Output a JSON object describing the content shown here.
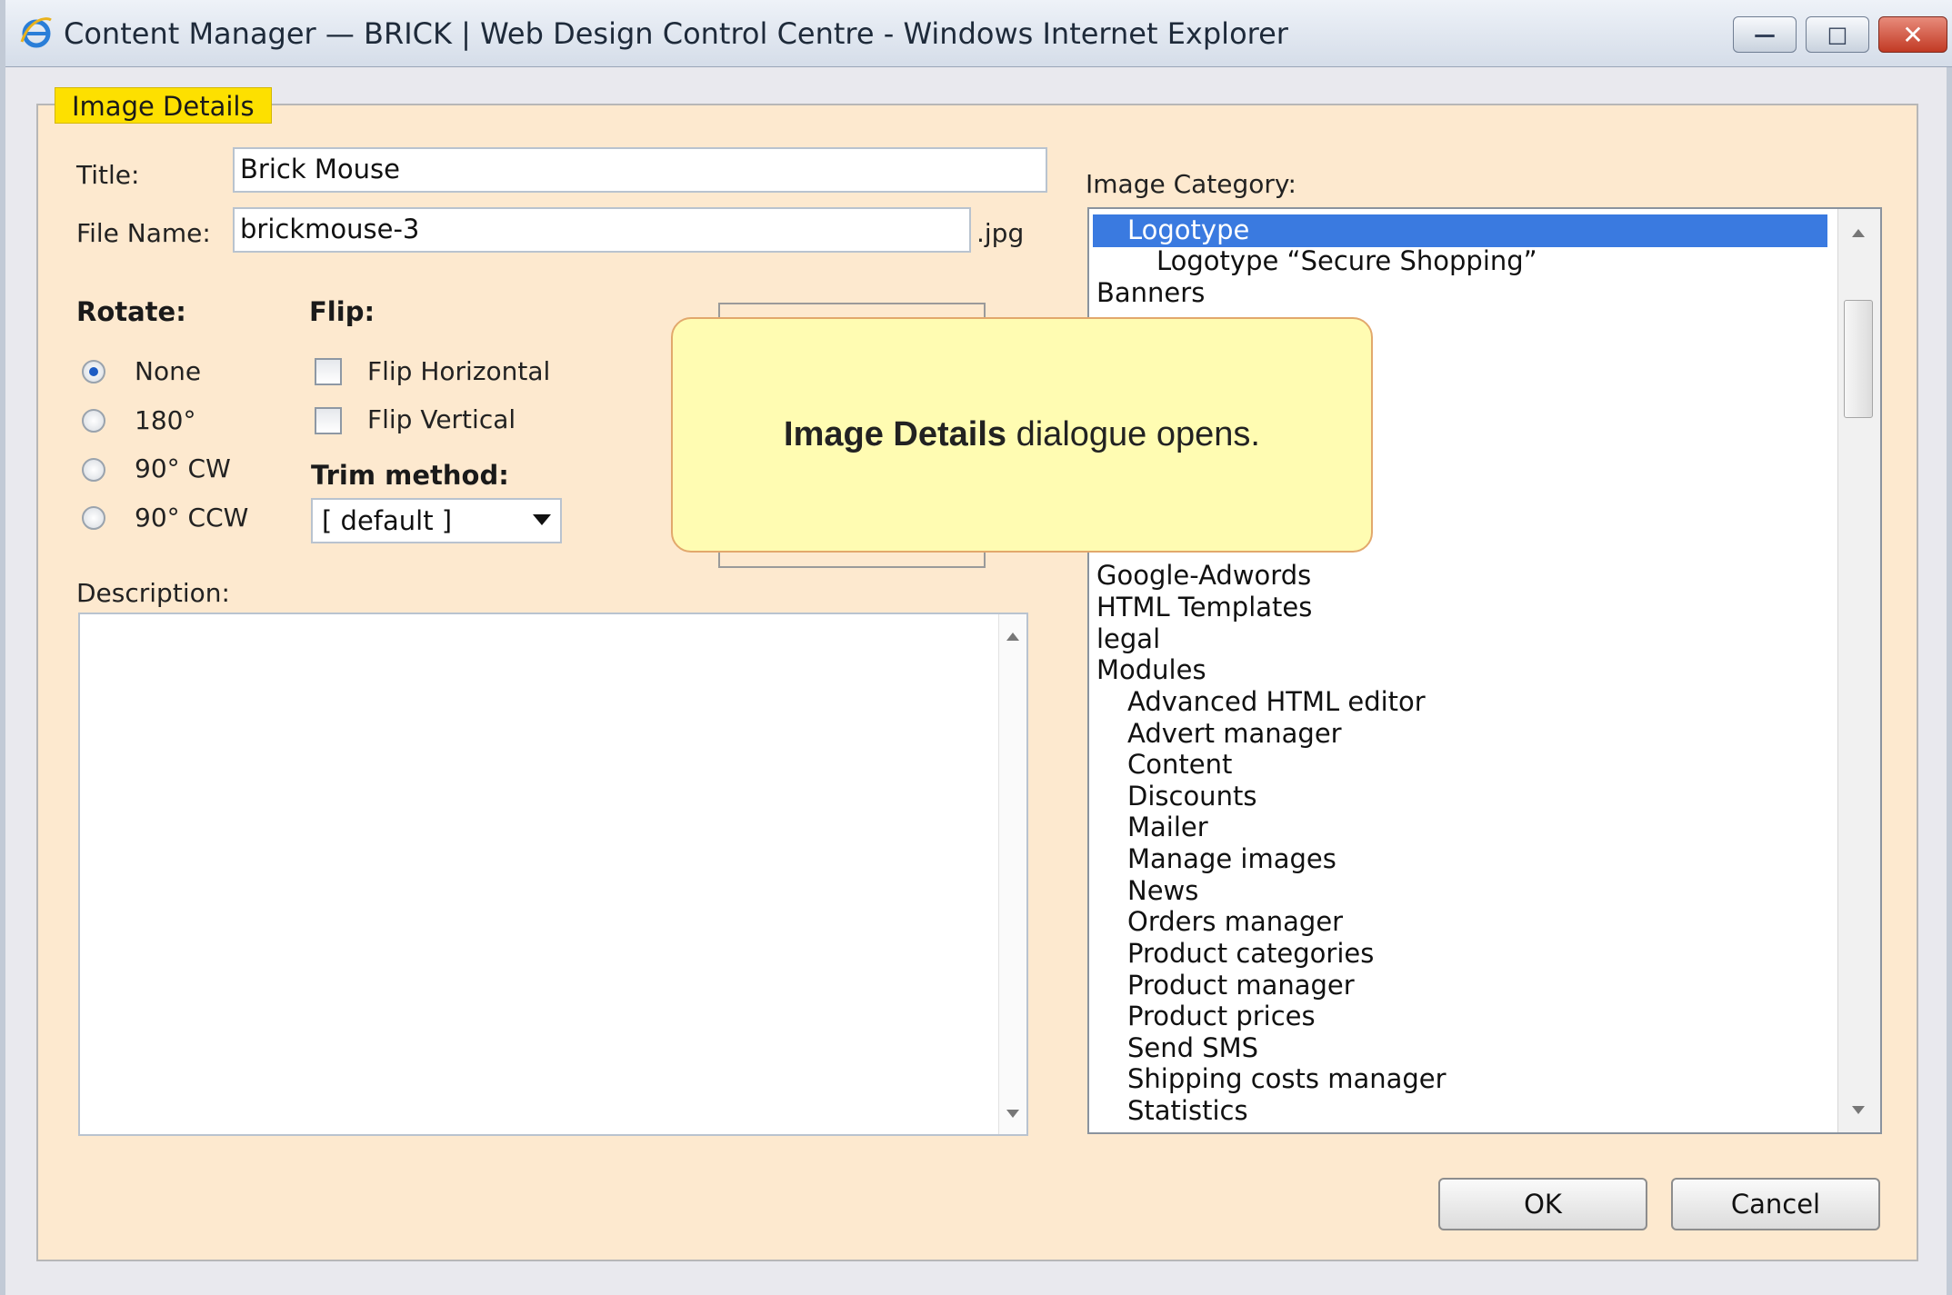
{
  "window": {
    "title": "Content Manager — BRICK | Web Design Control Centre - Windows Internet Explorer",
    "icon": "internet-explorer-icon",
    "controls": [
      "minimize",
      "maximize",
      "close"
    ]
  },
  "dialog": {
    "tab_label": "Image Details",
    "title_label": "Title:",
    "title_value": "Brick Mouse",
    "file_name_label": "File Name:",
    "file_name_value": "brickmouse-3",
    "file_ext": ".jpg",
    "rotate": {
      "label": "Rotate:",
      "options": [
        "None",
        "180°",
        "90° CW",
        "90° CCW"
      ],
      "selected": "None"
    },
    "flip": {
      "label": "Flip:",
      "options": [
        "Flip Horizontal",
        "Flip Vertical"
      ],
      "checked": []
    },
    "trim": {
      "label": "Trim method:",
      "selected": "[ default ]"
    },
    "description_label": "Description:",
    "description_value": "",
    "category_label": "Image Category:",
    "categories": [
      {
        "label": "Logotype",
        "level": 1,
        "selected": true
      },
      {
        "label": "Logotype “Secure Shopping”",
        "level": 2
      },
      {
        "label": "Banners",
        "level": 0
      },
      {
        "label": "Google-Adwords",
        "level": 0
      },
      {
        "label": "HTML Templates",
        "level": 0
      },
      {
        "label": "legal",
        "level": 0
      },
      {
        "label": "Modules",
        "level": 0
      },
      {
        "label": "Advanced HTML editor",
        "level": 1
      },
      {
        "label": "Advert manager",
        "level": 1
      },
      {
        "label": "Content",
        "level": 1
      },
      {
        "label": "Discounts",
        "level": 1
      },
      {
        "label": "Mailer",
        "level": 1
      },
      {
        "label": "Manage images",
        "level": 1
      },
      {
        "label": "News",
        "level": 1
      },
      {
        "label": "Orders manager",
        "level": 1
      },
      {
        "label": "Product categories",
        "level": 1
      },
      {
        "label": "Product manager",
        "level": 1
      },
      {
        "label": "Product prices",
        "level": 1
      },
      {
        "label": "Send SMS",
        "level": 1
      },
      {
        "label": "Shipping costs manager",
        "level": 1
      },
      {
        "label": "Statistics",
        "level": 1
      }
    ],
    "ok_label": "OK",
    "cancel_label": "Cancel"
  },
  "callout": {
    "bold": "Image Details",
    "rest": " dialogue opens."
  },
  "colors": {
    "panel_bg": "#fde9cf",
    "tab_bg": "#fde000",
    "selection": "#3a7ae0",
    "callout_bg": "#fffcb2",
    "callout_border": "#e2a86c"
  }
}
